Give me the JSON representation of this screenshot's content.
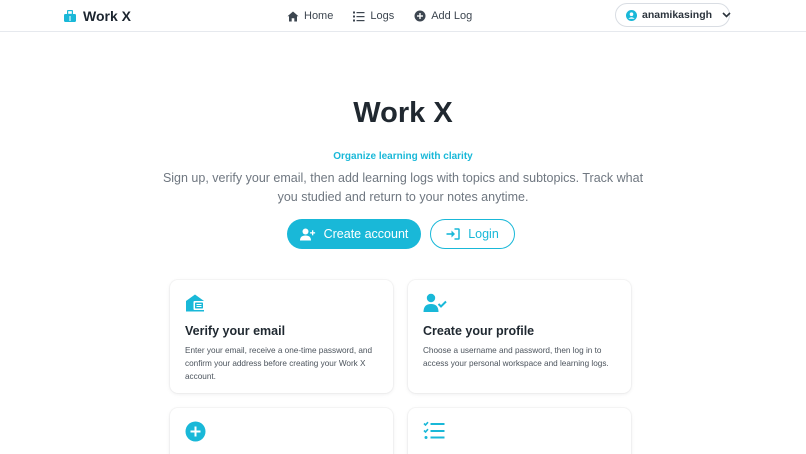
{
  "navbar": {
    "brand": "Work X",
    "links": [
      {
        "label": "Home",
        "icon": "home-icon"
      },
      {
        "label": "Logs",
        "icon": "list-icon"
      },
      {
        "label": "Add Log",
        "icon": "plus-circle-icon"
      }
    ],
    "user": {
      "name": "anamikasingh",
      "icon": "user-circle-icon"
    }
  },
  "hero": {
    "title": "Work X",
    "tagline": "Organize learning with clarity",
    "description": "Sign up, verify your email, then add learning logs with topics and subtopics. Track what you studied and return to your notes anytime.",
    "create_account_label": "Create account",
    "login_label": "Login"
  },
  "features": [
    {
      "icon": "email-verify-icon",
      "title": "Verify your email",
      "text": "Enter your email, receive a one-time password, and confirm your address before creating your Work X account."
    },
    {
      "icon": "user-check-icon",
      "title": "Create your profile",
      "text": "Choose a username and password, then log in to access your personal workspace and learning logs."
    },
    {
      "icon": "plus-circle-icon",
      "title": "",
      "text": ""
    },
    {
      "icon": "list-check-icon",
      "title": "",
      "text": ""
    }
  ],
  "colors": {
    "accent": "#19b8d8",
    "heading": "#202830",
    "muted": "#6f7780"
  }
}
